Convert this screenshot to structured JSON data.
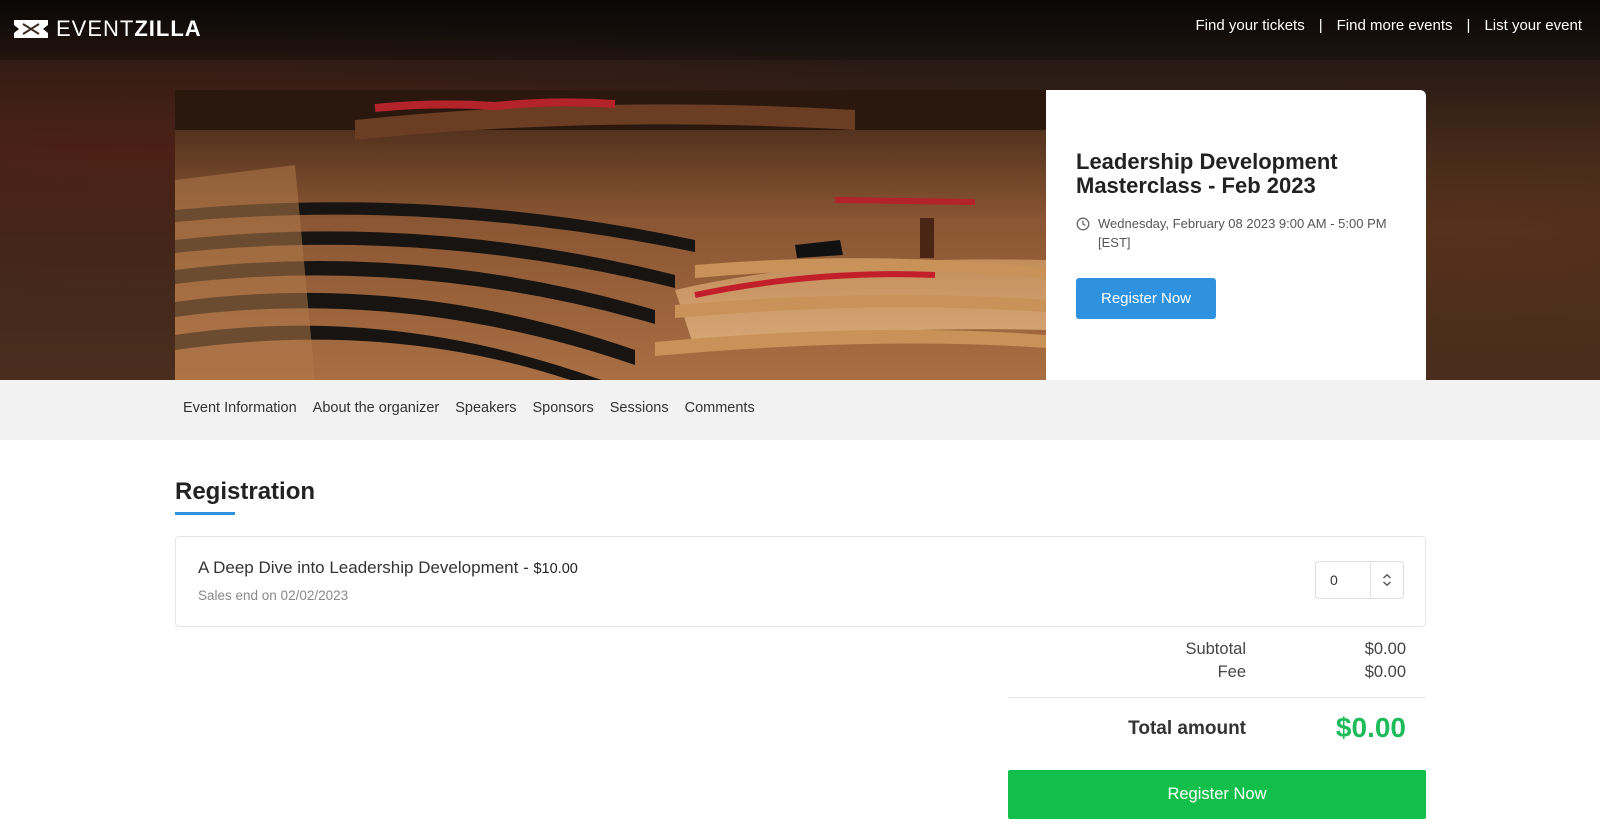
{
  "brand": {
    "name_light": "EVENT",
    "name_bold": "ZILLA"
  },
  "nav": {
    "links": [
      "Find your tickets",
      "Find more events",
      "List your event"
    ],
    "separator": "|"
  },
  "event": {
    "image_alt": "Concert hall panorama",
    "title": "Leadership Development Masterclass - Feb 2023",
    "date_line1": "Wednesday, February 08 2023 9:00 AM - 5:00 PM",
    "date_line2": "[EST]",
    "register_label": "Register Now"
  },
  "tabs": [
    "Event Information",
    "About the organizer",
    "Speakers",
    "Sponsors",
    "Sessions",
    "Comments"
  ],
  "registration": {
    "heading": "Registration",
    "ticket": {
      "name": "A Deep Dive into Leadership Development - ",
      "price": "$10.00",
      "sales_end": "Sales end on 02/02/2023",
      "quantity": "0"
    },
    "subtotal_label": "Subtotal",
    "subtotal_value": "$0.00",
    "fee_label": "Fee",
    "fee_value": "$0.00",
    "total_label": "Total amount",
    "total_value": "$0.00",
    "register_label": "Register Now"
  },
  "colors": {
    "accent_blue": "#2f92e0",
    "accent_green": "#12bf4b",
    "total_green": "#1dbb5a"
  },
  "icons": [
    "logo-ticket-icon",
    "clock-icon",
    "stepper-arrows-icon"
  ]
}
